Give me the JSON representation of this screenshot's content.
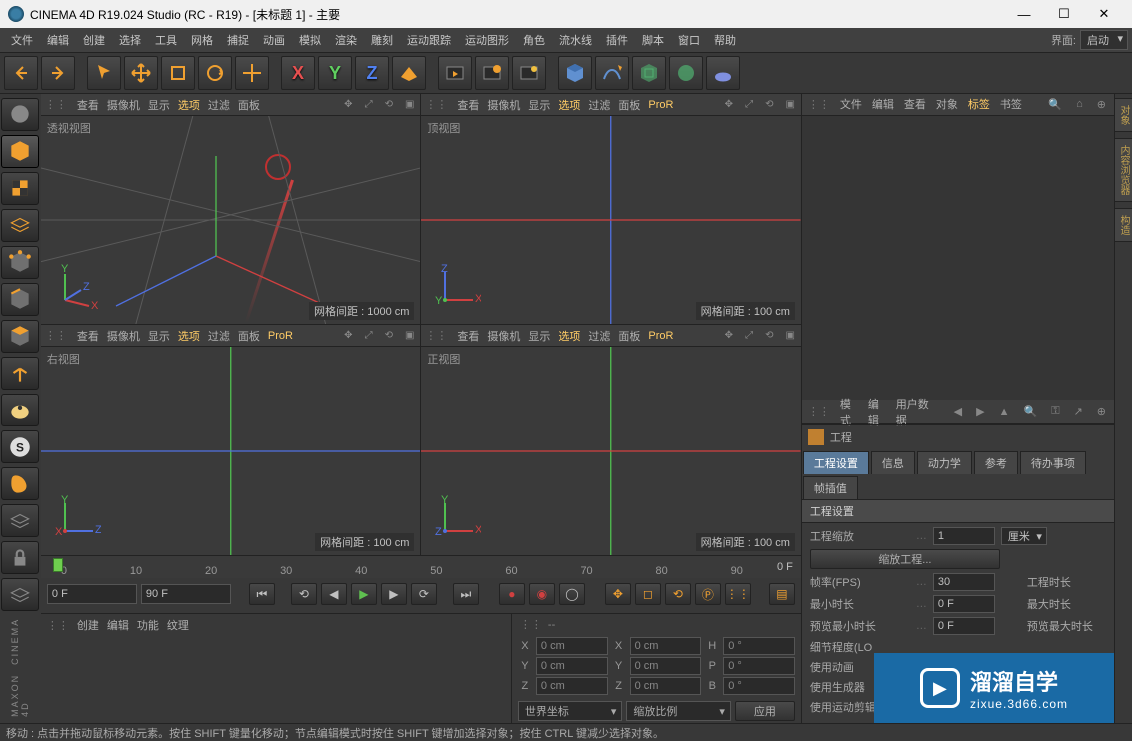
{
  "titlebar": {
    "title": "CINEMA 4D R19.024 Studio (RC - R19) - [未标题 1] - 主要"
  },
  "menubar": {
    "items": [
      "文件",
      "编辑",
      "创建",
      "选择",
      "工具",
      "网格",
      "捕捉",
      "动画",
      "模拟",
      "渲染",
      "雕刻",
      "运动跟踪",
      "运动图形",
      "角色",
      "流水线",
      "插件",
      "脚本",
      "窗口",
      "帮助"
    ],
    "layout_label": "界面:",
    "layout_value": "启动"
  },
  "viewports": {
    "menus": [
      "查看",
      "摄像机",
      "显示",
      "选项",
      "过滤",
      "面板"
    ],
    "pror": "ProR",
    "panes": [
      {
        "label": "透视视图",
        "grid": "网格间距 : 1000 cm"
      },
      {
        "label": "顶视图",
        "grid": "网格间距 : 100 cm"
      },
      {
        "label": "右视图",
        "grid": "网格间距 : 100 cm"
      },
      {
        "label": "正视图",
        "grid": "网格间距 : 100 cm"
      }
    ]
  },
  "timeline": {
    "ticks": [
      "0",
      "10",
      "20",
      "30",
      "40",
      "50",
      "60",
      "70",
      "80",
      "90"
    ],
    "frame_display": "0 F",
    "start_field": "0 F",
    "end_field": "90 F"
  },
  "coords": {
    "menu": [
      "创建",
      "编辑",
      "功能",
      "纹理"
    ],
    "header": "--",
    "rows": [
      {
        "a": "X",
        "av": "0 cm",
        "b": "X",
        "bv": "0 cm",
        "c": "H",
        "cv": "0 °"
      },
      {
        "a": "Y",
        "av": "0 cm",
        "b": "Y",
        "bv": "0 cm",
        "c": "P",
        "cv": "0 °"
      },
      {
        "a": "Z",
        "av": "0 cm",
        "b": "Z",
        "bv": "0 cm",
        "c": "B",
        "cv": "0 °"
      }
    ],
    "combo1": "世界坐标",
    "combo2": "缩放比例",
    "apply": "应用"
  },
  "objects_panel": {
    "menu": [
      "文件",
      "编辑",
      "查看",
      "对象",
      "标签",
      "书签"
    ]
  },
  "attrib_panel": {
    "menu": [
      "模式",
      "编辑",
      "用户数据"
    ],
    "title": "工程",
    "tabs": [
      "工程设置",
      "信息",
      "动力学",
      "参考",
      "待办事项",
      "帧插值"
    ],
    "section": "工程设置",
    "rows": {
      "scale_label": "工程缩放",
      "scale_value": "1",
      "scale_unit": "厘米",
      "button": "缩放工程...",
      "fps_label": "帧率(FPS)",
      "fps_value": "30",
      "duration_label": "工程时长",
      "min_label": "最小时长",
      "min_value": "0 F",
      "max_label": "最大时长",
      "pmin_label": "预览最小时长",
      "pmin_value": "0 F",
      "pmax_label": "预览最大时长",
      "lod_label": "细节程度(LO",
      "anim_label": "使用动画",
      "gen_label": "使用生成器",
      "mot_label": "使用运动剪辑"
    }
  },
  "right_tabs": [
    "对象",
    "内容浏览器",
    "构造"
  ],
  "statusbar": {
    "text": "移动 : 点击并拖动鼠标移动元素。按住 SHIFT 键量化移动；节点编辑模式时按住 SHIFT 键增加选择对象；按住 CTRL 键减少选择对象。"
  },
  "watermark": {
    "text": "溜溜自学",
    "url": "zixue.3d66.com"
  }
}
